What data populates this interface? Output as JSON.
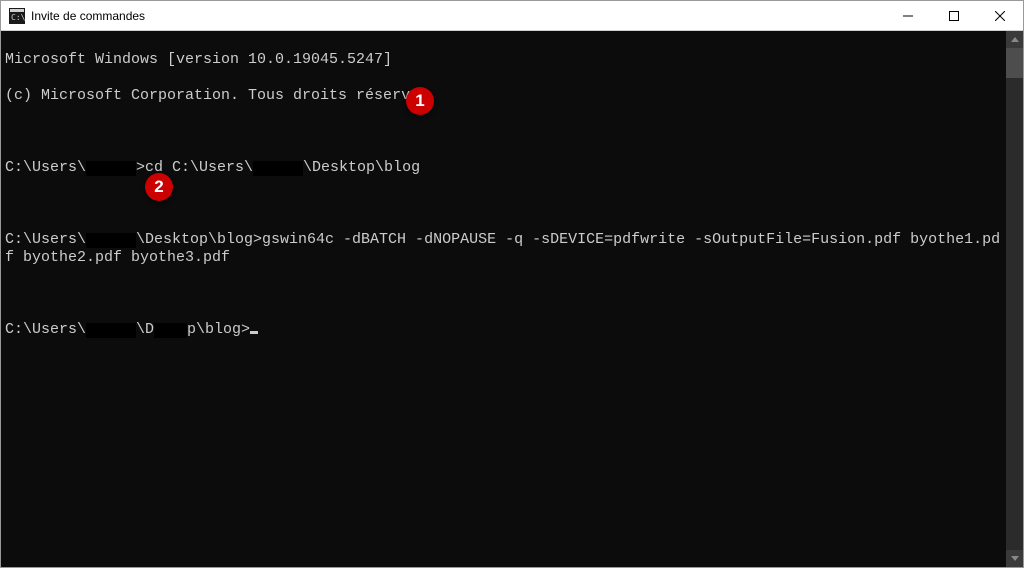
{
  "titlebar": {
    "title": "Invite de commandes"
  },
  "console": {
    "line1": "Microsoft Windows [version 10.0.19045.5247]",
    "line2": "(c) Microsoft Corporation. Tous droits réservés.",
    "prompt1_pre": "C:\\Users\\",
    "prompt1_post": ">cd C:\\Users\\",
    "prompt1_tail": "\\Desktop\\blog",
    "prompt2_pre": "C:\\Users\\",
    "prompt2_post": "\\Desktop\\blog>gswin64c -dBATCH -dNOPAUSE -q -sDEVICE=pdfwrite -sOutputFile=Fusion.pdf byothe1.pdf byothe2.pdf byothe3.pdf",
    "prompt3_pre": "C:\\Users\\",
    "prompt3_mid": "\\D",
    "prompt3_tail": "p\\blog>"
  },
  "annotations": {
    "a1": "1",
    "a2": "2"
  }
}
